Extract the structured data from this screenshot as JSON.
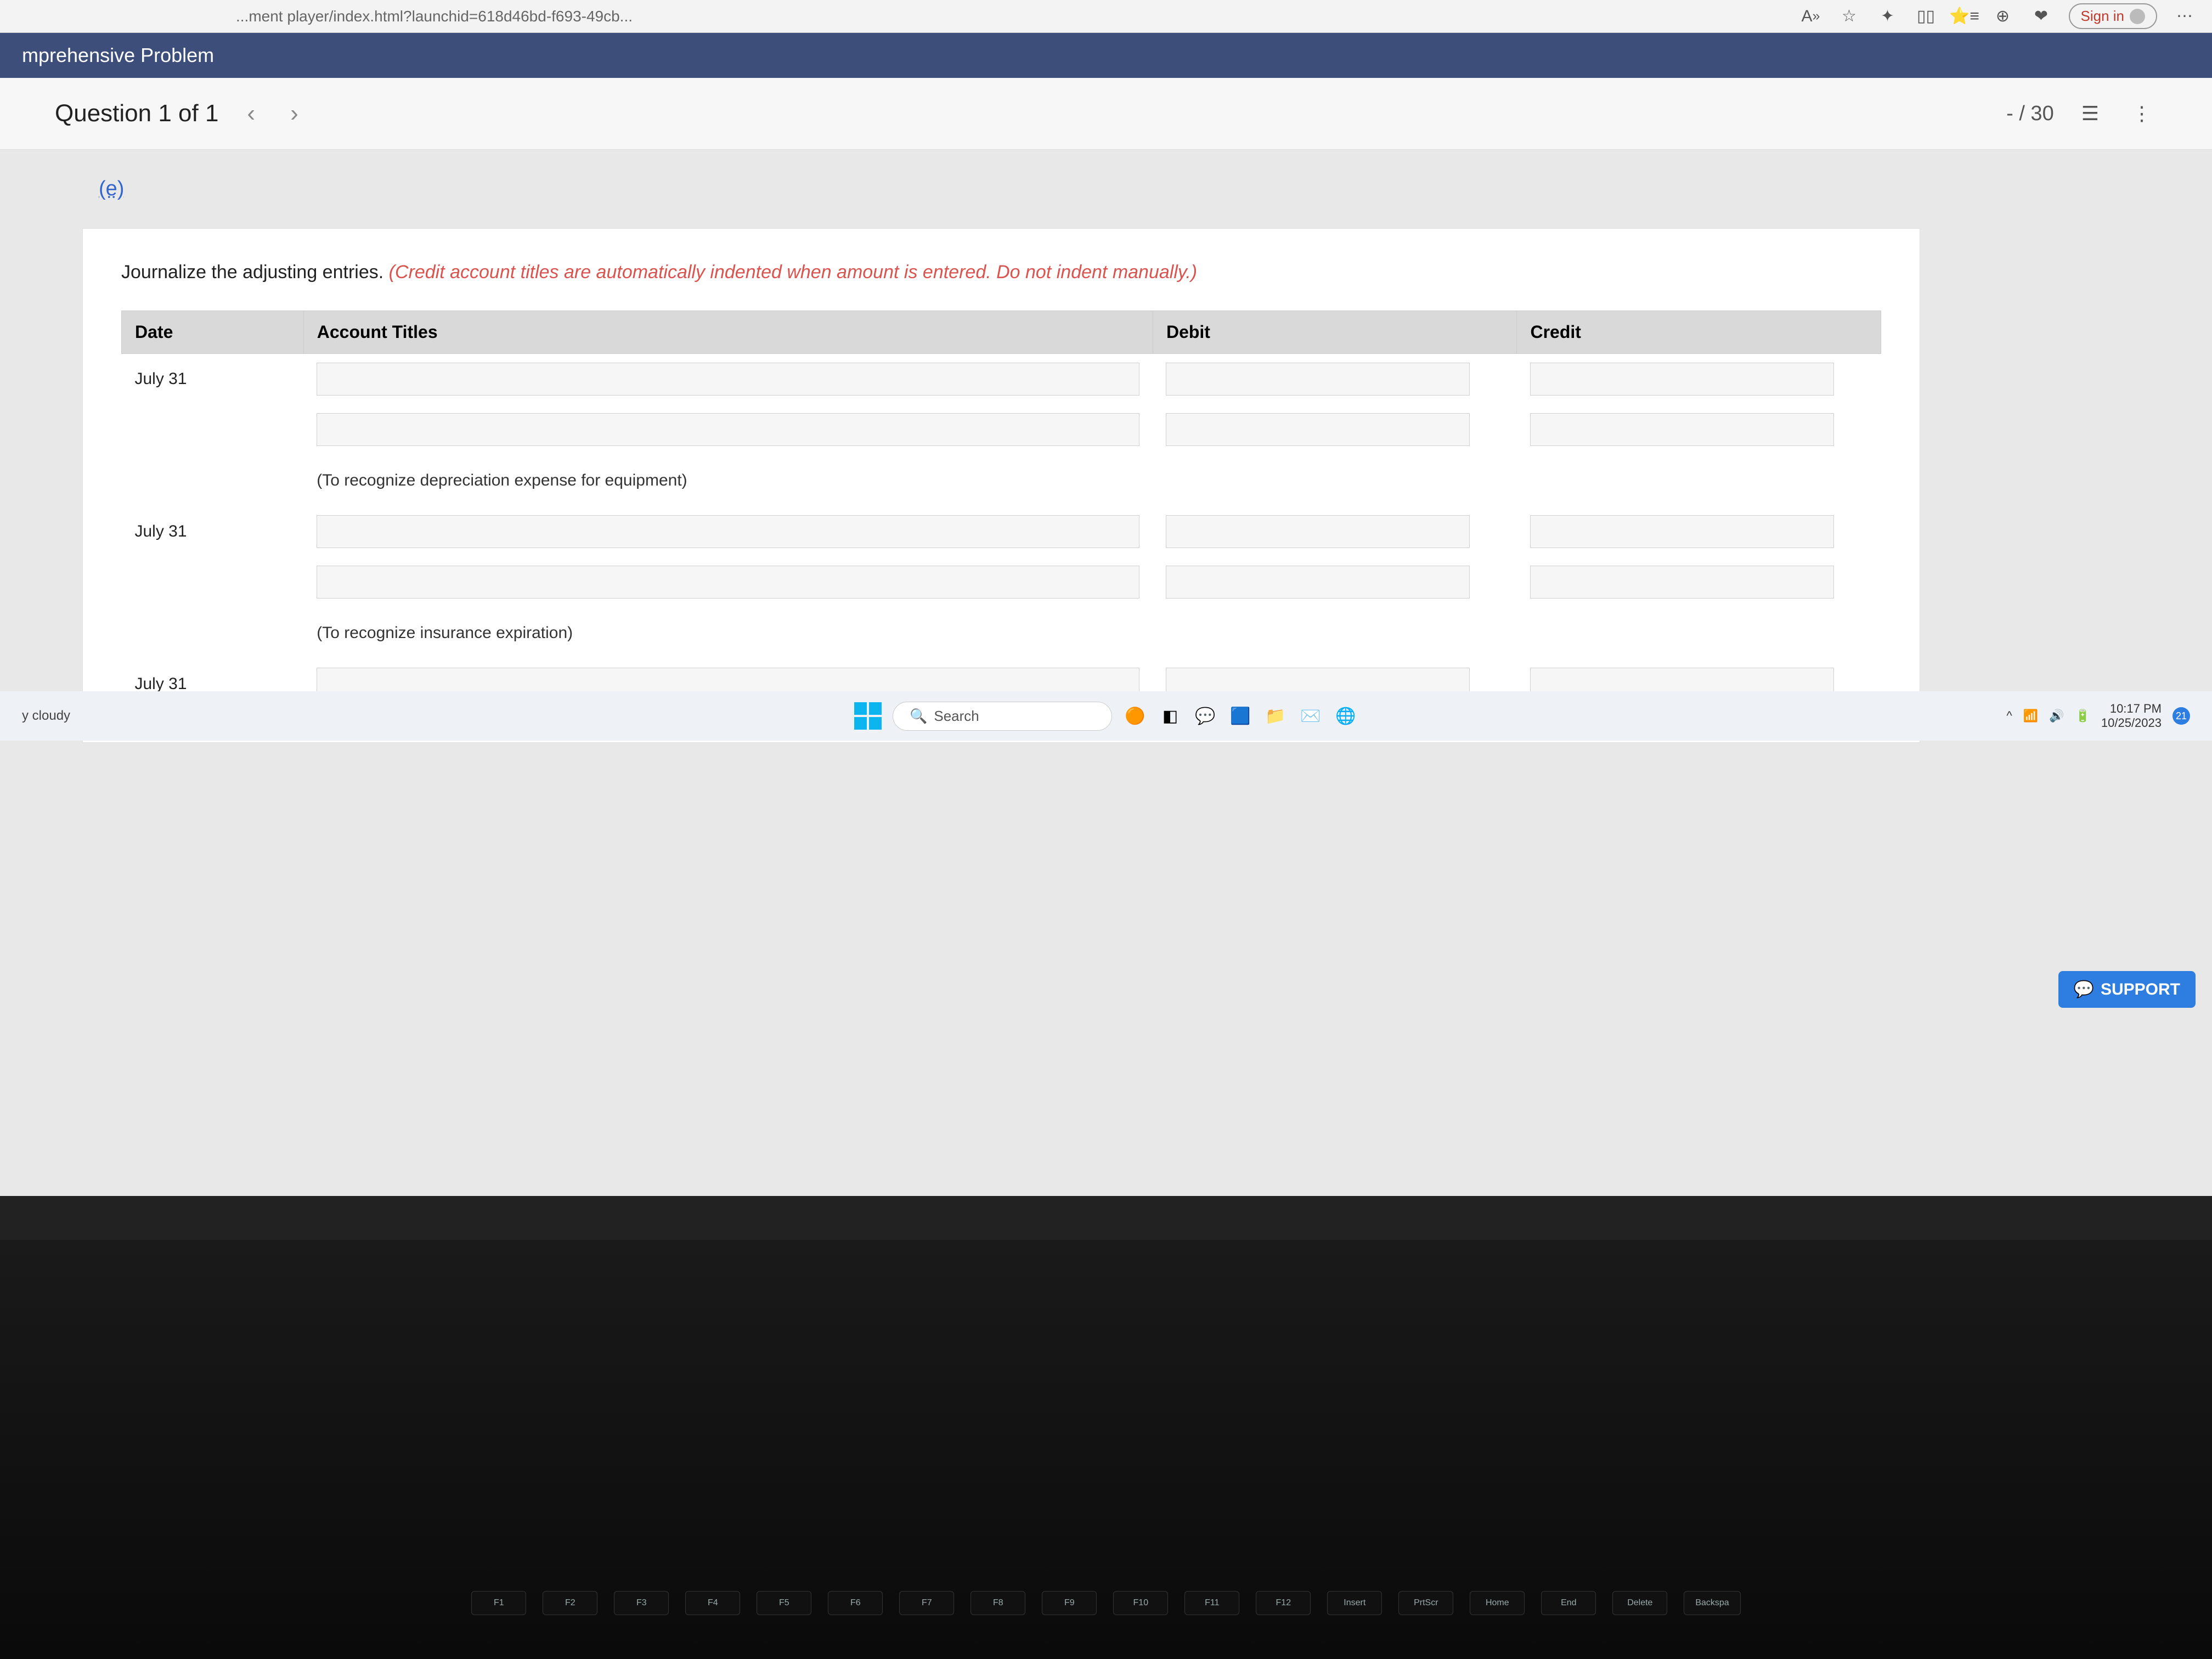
{
  "browser": {
    "url_fragment": "...ment player/index.html?launchid=618d46bd-f693-49cb...",
    "signin": "Sign in"
  },
  "app": {
    "title": "mprehensive Problem"
  },
  "question_bar": {
    "title": "Question 1 of 1",
    "score": "- / 30"
  },
  "part_label": "(e)",
  "instruction": {
    "lead": "Journalize the adjusting entries. ",
    "note": "(Credit account titles are automatically indented when amount is entered. Do not indent manually.)"
  },
  "table": {
    "headers": {
      "date": "Date",
      "titles": "Account Titles",
      "debit": "Debit",
      "credit": "Credit"
    },
    "rows": [
      {
        "date": "July 31",
        "desc": ""
      },
      {
        "date": "",
        "desc": ""
      },
      {
        "date": "",
        "desc": "(To recognize depreciation expense for equipment)",
        "is_desc": true
      },
      {
        "date": "July 31",
        "desc": ""
      },
      {
        "date": "",
        "desc": ""
      },
      {
        "date": "",
        "desc": "(To recognize insurance expiration)",
        "is_desc": true
      },
      {
        "date": "July 31",
        "desc": ""
      }
    ]
  },
  "support": "SUPPORT",
  "taskbar": {
    "weather": "y cloudy",
    "search_placeholder": "Search",
    "time": "10:17 PM",
    "date": "10/25/2023",
    "notif": "21"
  },
  "keys": [
    "F1",
    "F2",
    "F3",
    "F4",
    "F5",
    "F6",
    "F7",
    "F8",
    "F9",
    "F10",
    "F11",
    "F12",
    "Insert",
    "PrtScr",
    "Home",
    "End",
    "Delete",
    "Backspa"
  ]
}
